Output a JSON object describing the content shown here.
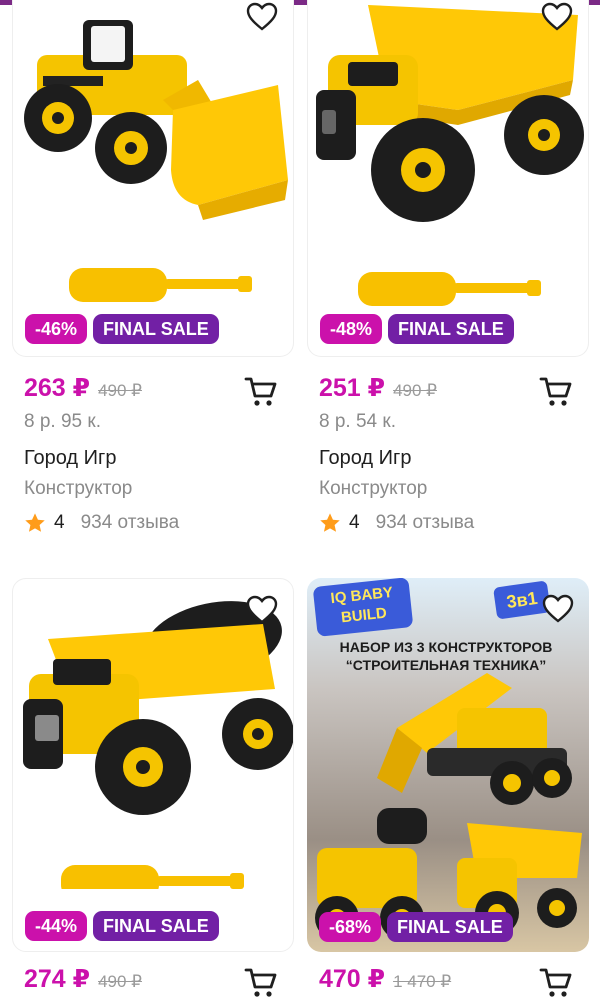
{
  "colors": {
    "accent": "#cb11ab",
    "sale_badge": "#7220a5",
    "discount_badge": "#cb11ab",
    "star": "#ff9c1a",
    "top_bar": "#7b2a86"
  },
  "products": [
    {
      "image": "toy-wheel-loader-with-screwdriver",
      "discount": "-46%",
      "sale_label": "FINAL SALE",
      "price": "263 ₽",
      "old_price": "490 ₽",
      "installment": "8 р. 95 к.",
      "brand": "Город Игр",
      "category": "Конструктор",
      "rating": "4",
      "reviews": "934 отзыва"
    },
    {
      "image": "toy-dump-truck-with-screwdriver",
      "discount": "-48%",
      "sale_label": "FINAL SALE",
      "price": "251 ₽",
      "old_price": "490 ₽",
      "installment": "8 р. 54 к.",
      "brand": "Город Игр",
      "category": "Конструктор",
      "rating": "4",
      "reviews": "934 отзыва"
    },
    {
      "image": "toy-concrete-mixer-with-screwdriver",
      "discount": "-44%",
      "sale_label": "FINAL SALE",
      "price": "274 ₽",
      "old_price": "490 ₽"
    },
    {
      "image": "construction-vehicles-set-promo",
      "promo_brand": "IQ BABY BUILD",
      "promo_badge": "3в1",
      "promo_title_line1": "НАБОР ИЗ 3 КОНСТРУКТОРОВ",
      "promo_title_line2": "“СТРОИТЕЛЬНАЯ ТЕХНИКА”",
      "discount": "-68%",
      "sale_label": "FINAL SALE",
      "price": "470 ₽",
      "old_price": "1 470 ₽"
    }
  ]
}
